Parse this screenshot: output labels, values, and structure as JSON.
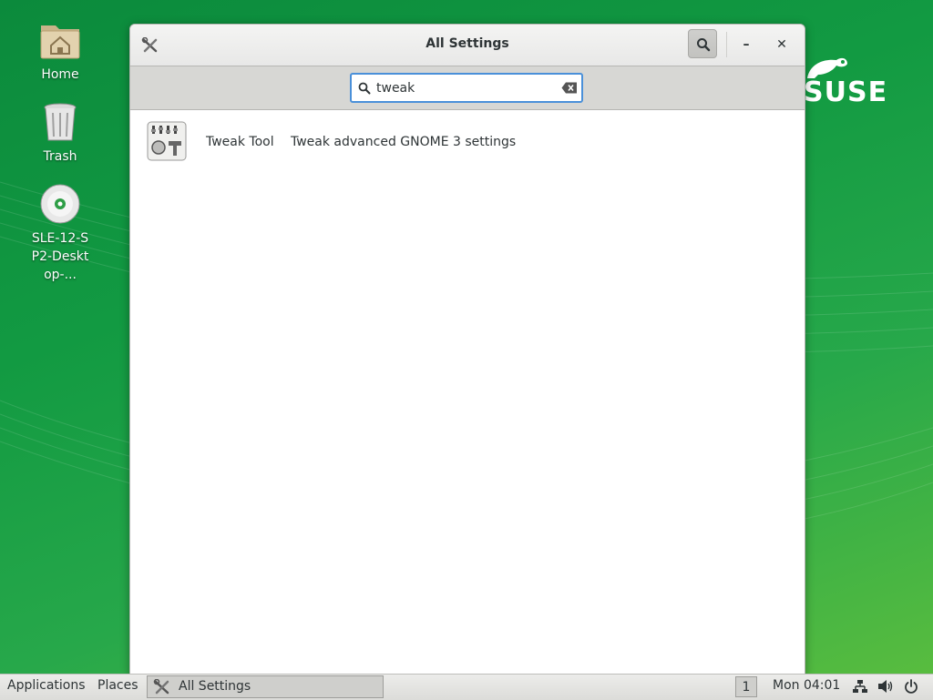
{
  "desktop": {
    "icons": [
      {
        "label": "Home"
      },
      {
        "label": "Trash"
      },
      {
        "label": "SLE-12-SP2-Desktop-..."
      }
    ],
    "logo_text": "SUSE"
  },
  "window": {
    "title": "All Settings",
    "search": {
      "value": "tweak",
      "placeholder": ""
    },
    "results": [
      {
        "name": "Tweak Tool",
        "description": "Tweak advanced GNOME 3 settings",
        "icon": "tweak-tool-icon"
      }
    ]
  },
  "taskbar": {
    "applications_label": "Applications",
    "places_label": "Places",
    "task_label": "All Settings",
    "workspace": "1",
    "clock": "Mon 04:01"
  },
  "colors": {
    "accent": "#4a90d9",
    "desktop_green": "#129a42"
  }
}
